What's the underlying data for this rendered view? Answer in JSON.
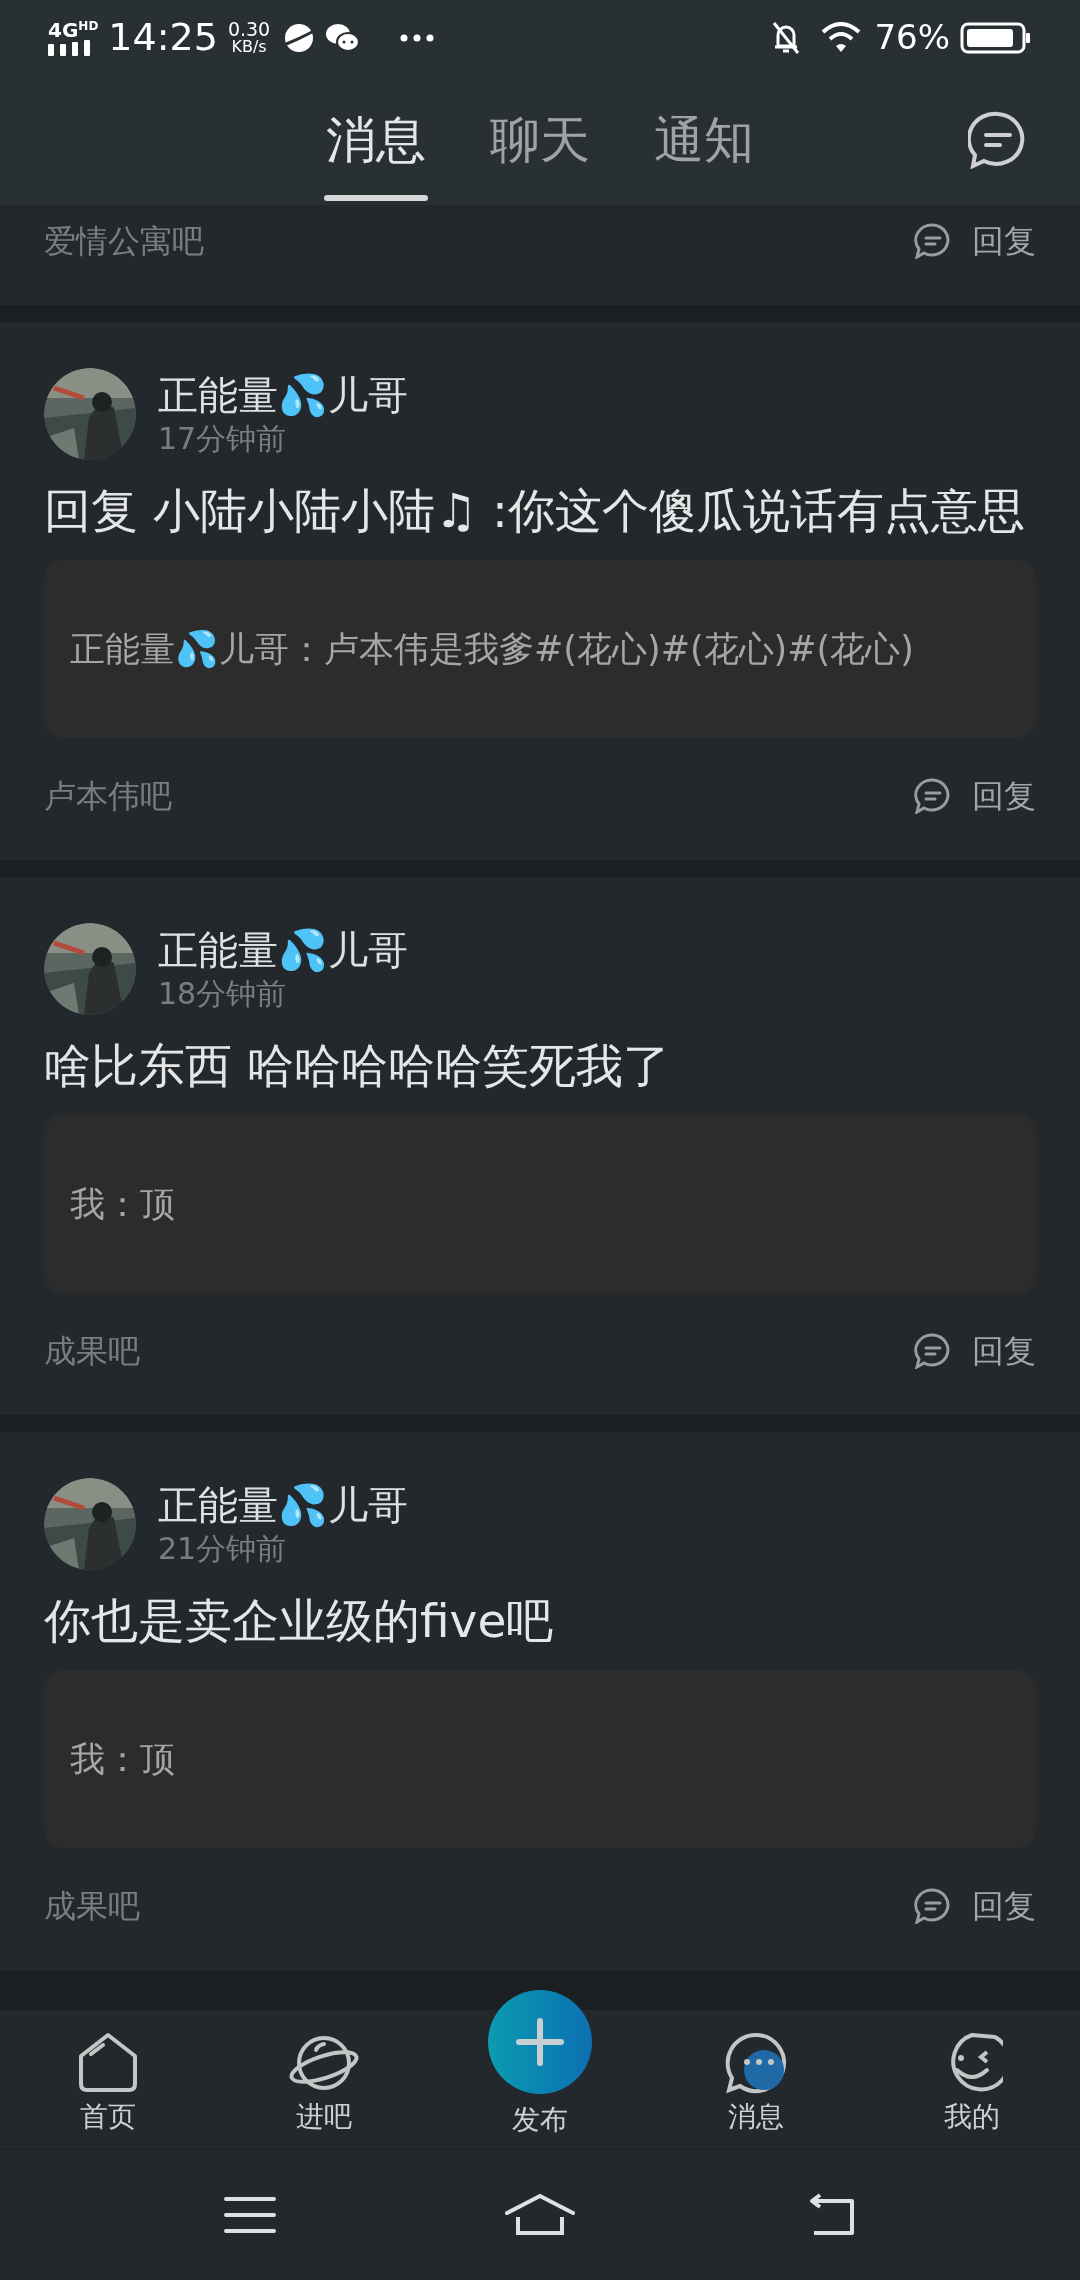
{
  "status_bar": {
    "network": "4G",
    "network_badge": "HD",
    "time": "14:25",
    "speed": "0.30",
    "speed_unit": "KB/s",
    "battery": "76%"
  },
  "tabs": [
    {
      "label": "消息",
      "selected": true
    },
    {
      "label": "聊天",
      "selected": false
    },
    {
      "label": "通知",
      "selected": false
    }
  ],
  "posts": [
    {
      "forum": "爱情公寓吧",
      "reply_label": "回复"
    },
    {
      "author": "正能量💦儿哥",
      "time": "17分钟前",
      "text": "回复 小陆小陆小陆♫ :你这个傻瓜说话有点意思",
      "quote": "正能量💦儿哥：卢本伟是我爹#(花心)#(花心)#(花心)",
      "forum": "卢本伟吧",
      "reply_label": "回复"
    },
    {
      "author": "正能量💦儿哥",
      "time": "18分钟前",
      "text": "啥比东西 哈哈哈哈哈笑死我了",
      "quote": "我：顶",
      "forum": "成果吧",
      "reply_label": "回复"
    },
    {
      "author": "正能量💦儿哥",
      "time": "21分钟前",
      "text": "你也是卖企业级的five吧",
      "quote": "我：顶",
      "forum": "成果吧",
      "reply_label": "回复"
    }
  ],
  "bottom_nav": [
    {
      "label": "首页",
      "kind": "home"
    },
    {
      "label": "进吧",
      "kind": "planet"
    },
    {
      "label": "发布",
      "kind": "compose"
    },
    {
      "label": "消息",
      "kind": "message"
    },
    {
      "label": "我的",
      "kind": "profile"
    }
  ]
}
